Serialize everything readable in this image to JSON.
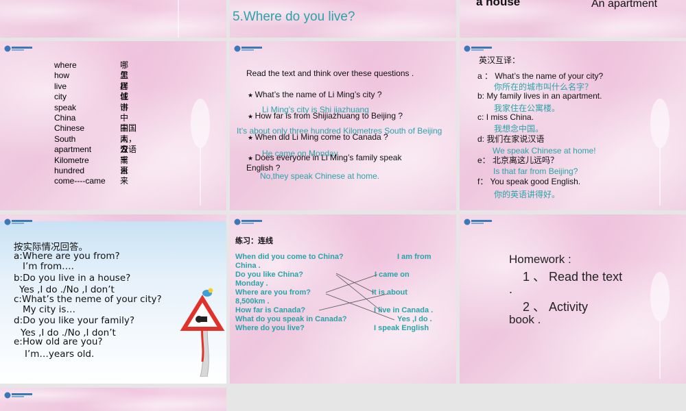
{
  "slides": {
    "s1": {},
    "s2": {
      "title": "5.Where do you live?"
    },
    "s3": {
      "left": "a house",
      "right": "An apartment"
    },
    "s4": {
      "vocab": [
        {
          "en": "where",
          "zh": "哪里"
        },
        {
          "en": "how",
          "zh": "怎样"
        },
        {
          "en": "live",
          "zh": "居住"
        },
        {
          "en": "city",
          "zh": "城市"
        },
        {
          "en": "speak",
          "zh": "讲"
        },
        {
          "en": "China",
          "zh": "中国"
        },
        {
          "en": "Chinese",
          "zh": "中国人，汉语"
        },
        {
          "en": "South",
          "zh": "南方"
        },
        {
          "en": "apartment",
          "zh": "公寓"
        },
        {
          "en": "Kilometre",
          "zh": "千米"
        },
        {
          "en": "hundred",
          "zh": "百"
        },
        {
          "en": "come----came",
          "zh": "来"
        }
      ]
    },
    "s5": {
      "intro": "Read   the   text  and think over these questions .",
      "q1": "What’s the name of Li Ming’s city ?",
      "a1": "Li Ming’s city is Shi jiazhuang",
      "q2": "How far is from Shijiazhuang to Beijing ?",
      "a2": "It’s about only three hundred Kilometres South of Beijing",
      "q3": "When did Li Ming come to Canada ?",
      "a3": "He came on Monday",
      "q4a": "Does everyone in Li Ming’s family speak",
      "q4b": "English ?",
      "a4": "No,they speak Chinese at home."
    },
    "s6": {
      "title": "英汉互译：",
      "items": [
        {
          "label": "a ：",
          "text": "What’s the name of your city?",
          "answer": "你所在的城市叫什么名字？"
        },
        {
          "label": "b:",
          "text": "My family lives in an apartment.",
          "answer": "我家住在公寓楼。"
        },
        {
          "label": "c:",
          "text": "I miss China.",
          "answer": "我想念中国。"
        },
        {
          "label": "d:",
          "text": "我们在家说汉语",
          "answer": "We speak Chinese at home!"
        },
        {
          "label": "e：",
          "text": "北京离这儿远吗？",
          "answer": "Is that far from Beijing?"
        },
        {
          "label": "f：",
          "text": "You speak good English.",
          "answer": "你的英语讲得好。"
        }
      ]
    },
    "s7": {
      "title": "按实际情况回答。",
      "lines": [
        "a:Where are you from?",
        "I’m from….",
        "b:Do you live in a house?",
        "Yes ,I do ./No ,I don’t",
        "c:What’s the neme of your city?",
        "My city is…",
        "d:Do you like your family?",
        "Yes ,I do ./No ,I don’t",
        "e:How old are you?",
        "I’m…years old."
      ]
    },
    "s8": {
      "title": "练习：连线",
      "left": [
        "When did you come to China?",
        "China .",
        "Do you like China?",
        "Monday .",
        "Where are you from?",
        "8,500km .",
        "How far is Canada?",
        "What do you speak in Canada?",
        "Where do you live?"
      ],
      "right": [
        "I am from",
        "I came on",
        "It is about",
        "I live in Canada .",
        "Yes ,I do .",
        "I speak English"
      ]
    },
    "s9": {
      "title": "Homework :",
      "line1": "1 、 Read the text",
      "line2": ".",
      "line3": "2 、 Activity",
      "line4": "book ."
    }
  }
}
